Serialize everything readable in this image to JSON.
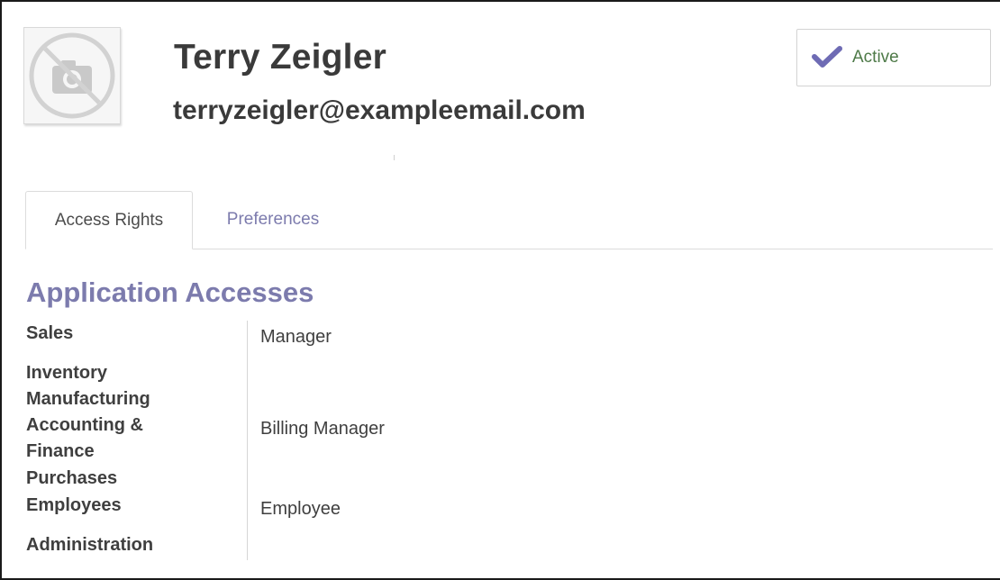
{
  "header": {
    "name": "Terry Zeigler",
    "email": "terryzeigler@exampleemail.com",
    "avatar_icon": "no-photo-icon"
  },
  "status": {
    "label": "Active",
    "icon": "check-icon",
    "check_color": "#6e6bb4"
  },
  "tabs": [
    {
      "label": "Access Rights",
      "active": true
    },
    {
      "label": "Preferences",
      "active": false
    }
  ],
  "section": {
    "title": "Application Accesses"
  },
  "accesses": [
    {
      "app": "Sales",
      "role": "Manager"
    },
    {
      "app": "Inventory",
      "role": ""
    },
    {
      "app": "Manufacturing",
      "role": ""
    },
    {
      "app": "Accounting & Finance",
      "role": "Billing Manager"
    },
    {
      "app": "Purchases",
      "role": ""
    },
    {
      "app": "Employees",
      "role": "Employee"
    },
    {
      "app": "Administration",
      "role": ""
    }
  ],
  "colors": {
    "accent": "#7c7bad",
    "text": "#3f3f3f"
  }
}
